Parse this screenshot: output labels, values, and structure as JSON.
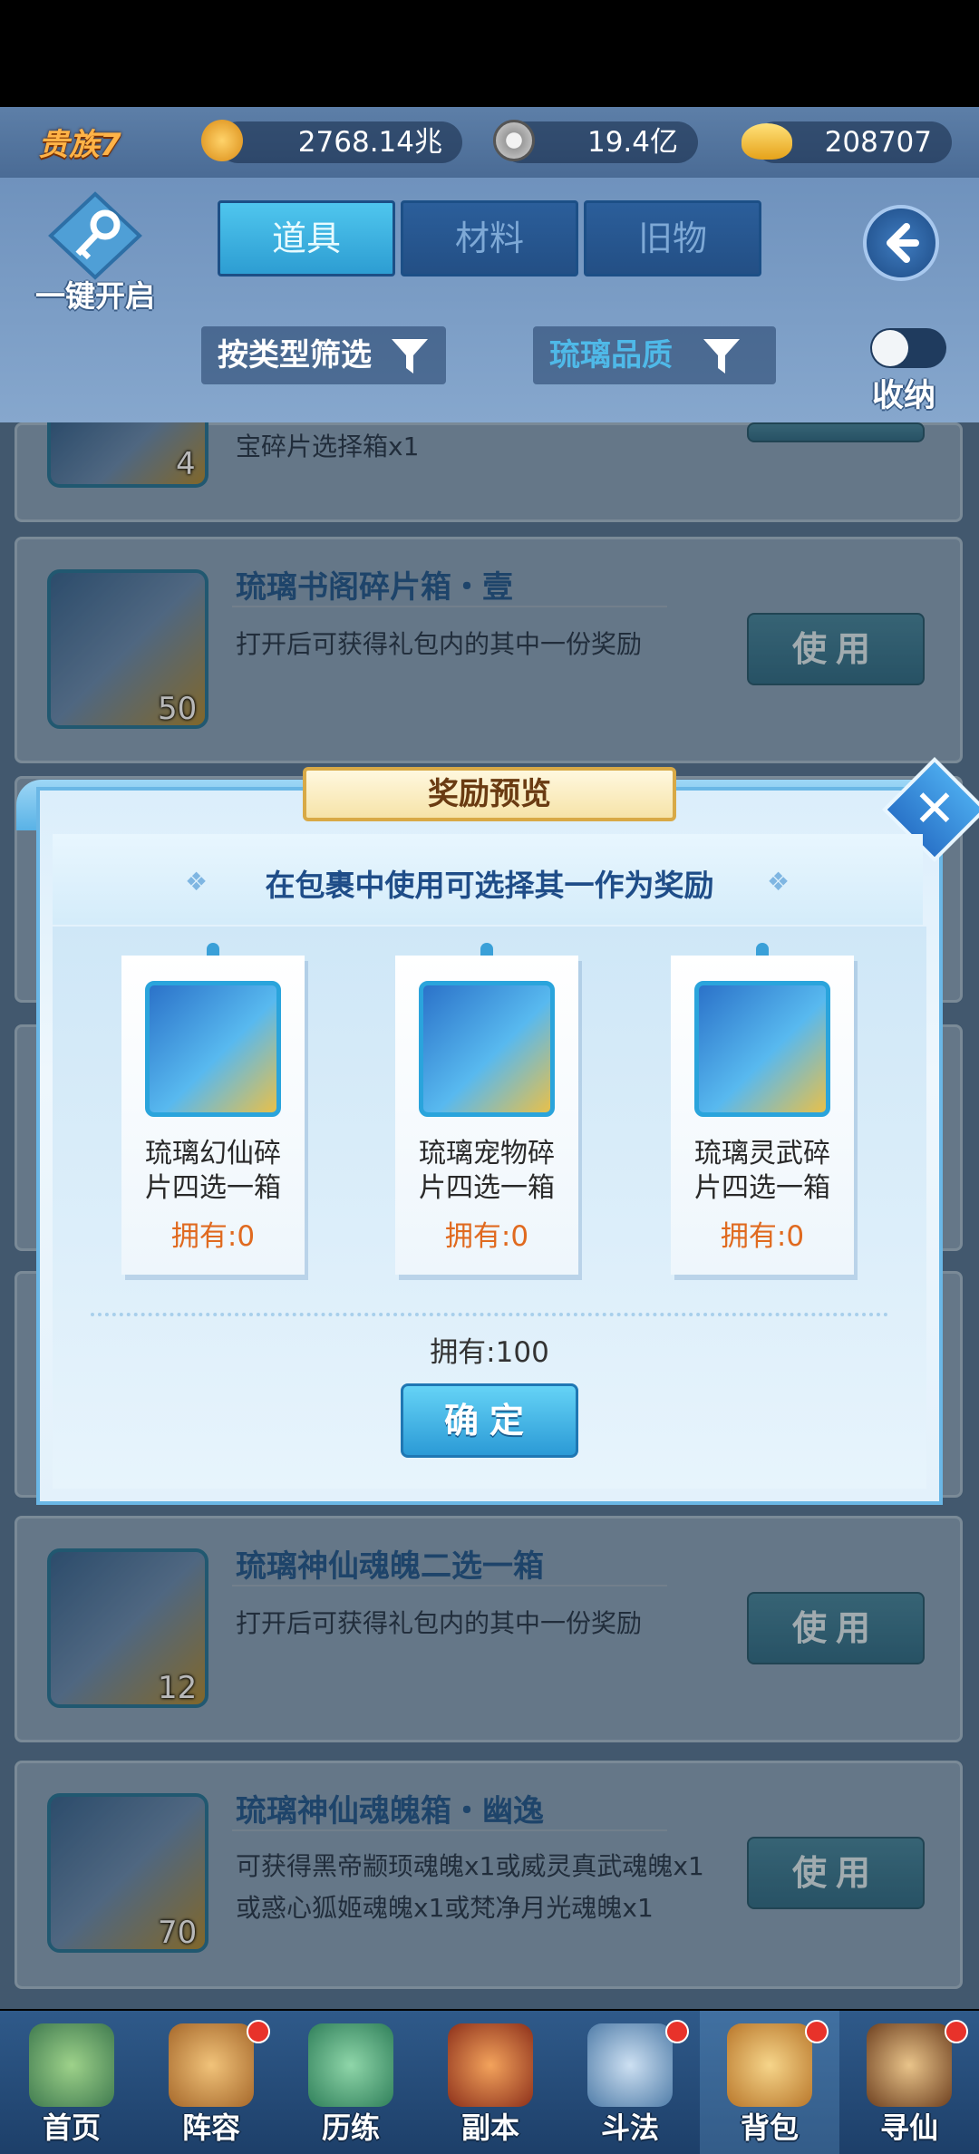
{
  "top_bar": {
    "vip": "贵族7",
    "power_value": "2768.14兆",
    "coins_value": "19.4亿",
    "ingots_value": "208707"
  },
  "header": {
    "one_click_open": "一键开启",
    "tabs": [
      {
        "label": "道具",
        "active": true
      },
      {
        "label": "材料",
        "active": false
      },
      {
        "label": "旧物",
        "active": false
      }
    ],
    "filter_type": "按类型筛选",
    "filter_quality": "琉璃品质",
    "collapse_label": "收纳"
  },
  "items": [
    {
      "title": "",
      "desc": "宝碎片选择箱x1",
      "count": "4"
    },
    {
      "title": "琉璃书阁碎片箱・壹",
      "desc": "打开后可获得礼包内的其中一份奖励",
      "count": "50",
      "button": "使用"
    },
    {
      "title": "琉璃神仙魂魄二选一箱",
      "desc": "打开后可获得礼包内的其中一份奖励",
      "count": "12",
      "button": "使用"
    },
    {
      "title": "琉璃神仙魂魄箱・幽逸",
      "desc_line1": "可获得黑帝颛顼魂魄x1或威灵真武魂魄x1",
      "desc_line2": "或惑心狐姬魂魄x1或梵净月光魂魄x1",
      "count": "70",
      "button": "使用"
    }
  ],
  "modal": {
    "title": "奖励预览",
    "subtitle": "在包裹中使用可选择其一作为奖励",
    "rewards": [
      {
        "name_line1": "琉璃幻仙碎",
        "name_line2": "片四选一箱",
        "owned": "拥有:0"
      },
      {
        "name_line1": "琉璃宠物碎",
        "name_line2": "片四选一箱",
        "owned": "拥有:0"
      },
      {
        "name_line1": "琉璃灵武碎",
        "name_line2": "片四选一箱",
        "owned": "拥有:0"
      }
    ],
    "owned_total": "拥有:100",
    "confirm": "确定"
  },
  "bottom_nav": [
    {
      "label": "首页",
      "badge": false
    },
    {
      "label": "阵容",
      "badge": true
    },
    {
      "label": "历练",
      "badge": false
    },
    {
      "label": "副本",
      "badge": false
    },
    {
      "label": "斗法",
      "badge": true
    },
    {
      "label": "背包",
      "badge": true
    },
    {
      "label": "寻仙",
      "badge": true
    }
  ]
}
